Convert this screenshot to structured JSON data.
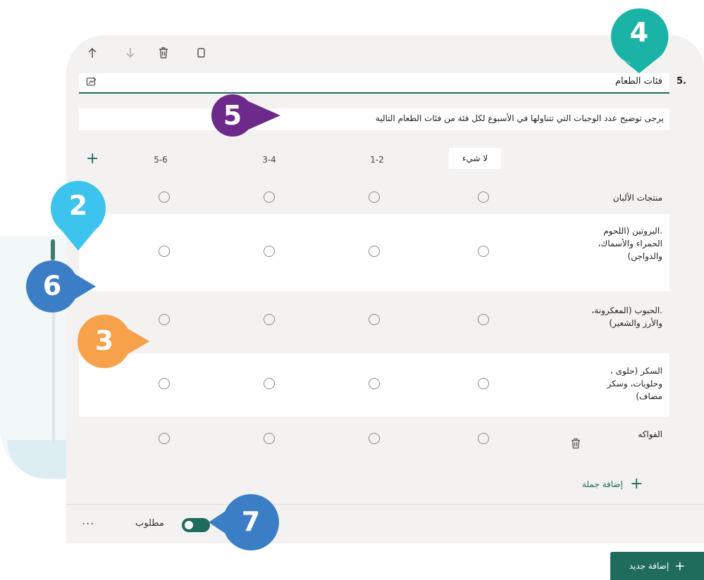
{
  "toolbar": {
    "icons": [
      "arrow-up-icon",
      "arrow-down-icon",
      "trash-icon",
      "copy-icon"
    ]
  },
  "question": {
    "number": "5.",
    "title": "فئات الطعام",
    "subtitle": "يرجى توضيح عدد الوجبات التي تتناولها في الأسبوع لكل فئة من فئات الطعام التالية"
  },
  "columns": [
    "لا شيء",
    "1-2",
    "3-4",
    "5-6"
  ],
  "rows": [
    {
      "label": "منتجات الألبان"
    },
    {
      "label": ".البروتين (اللحوم الحمراء والأسماك، والدواجن)"
    },
    {
      "label": ".الحبوب (المعكرونة، والأرز والشعير)"
    },
    {
      "label": "السكر (حلوى ، وحلويات، وسكر مضاف)"
    },
    {
      "label": "الفواكه"
    }
  ],
  "add_row_label": "إضافة جملة",
  "required_label": "مطلوب",
  "more_label": "...",
  "add_new_label": "إضافة جديد",
  "callouts": {
    "c2": "2",
    "c3": "3",
    "c4": "4",
    "c5": "5",
    "c6": "6",
    "c7": "7"
  },
  "colors": {
    "accent": "#1f6b5c",
    "callout_teal": "#1ab3a6",
    "callout_purple": "#6e2a8a",
    "callout_lightblue": "#3cc3ee",
    "callout_orange": "#f7a14b",
    "callout_blue": "#3b7ec6"
  }
}
